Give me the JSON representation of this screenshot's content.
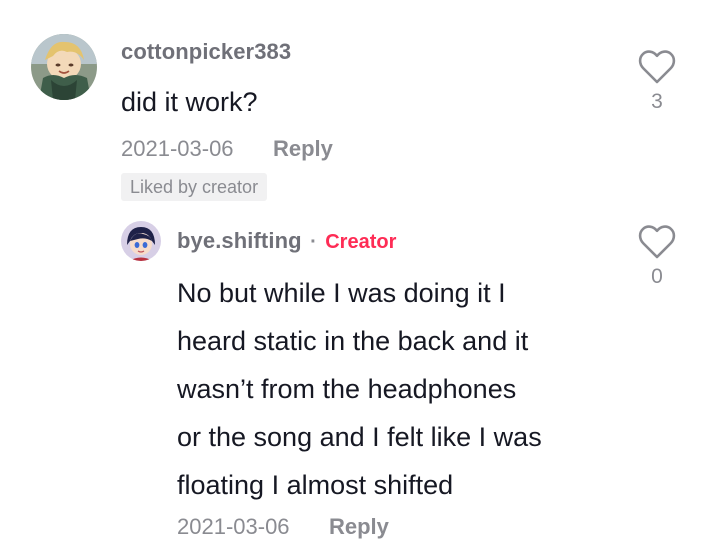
{
  "comment": {
    "username": "cottonpicker383",
    "text": "did it work?",
    "date": "2021-03-06",
    "reply_label": "Reply",
    "badge": "Liked by creator",
    "like_count": "3"
  },
  "reply": {
    "username": "bye.shifting",
    "separator": "·",
    "creator_label": "Creator",
    "text_lines": [
      "No but while I was doing it I",
      "heard static in the back and it",
      "wasn’t from the headphones",
      "or the song and I felt like I was",
      "floating I almost shifted"
    ],
    "date": "2021-03-06",
    "reply_label": "Reply",
    "like_count": "0"
  },
  "icons": {
    "like": "heart-outline-icon"
  },
  "colors": {
    "creator_accent": "#fe2c55",
    "muted_text": "#8a8b91",
    "primary_text": "#161823"
  }
}
